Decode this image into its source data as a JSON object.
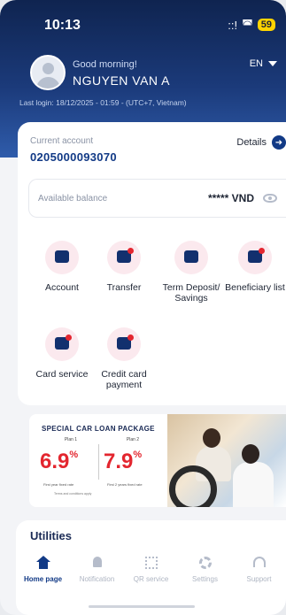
{
  "status_bar": {
    "time": "10:13",
    "signal": "::!",
    "wifi": "wifi-icon",
    "battery": "59"
  },
  "user": {
    "greeting": "Good morning!",
    "name": "NGUYEN VAN A",
    "last_login": "Last login: 18/12/2025 - 01:59 - (UTC+7, Vietnam)"
  },
  "language": "EN",
  "account": {
    "label": "Current account",
    "number": "0205000093070",
    "details_label": "Details",
    "balance_label": "Available balance",
    "balance_value": "***** VND"
  },
  "features": [
    {
      "label": "Account",
      "icon": "wallet-icon"
    },
    {
      "label": "Transfer",
      "icon": "transfer-icon"
    },
    {
      "label": "Term Deposit/ Savings",
      "icon": "piggy-bank-icon"
    },
    {
      "label": "Beneficiary list",
      "icon": "contacts-book-icon"
    },
    {
      "label": "Card service",
      "icon": "card-icon"
    },
    {
      "label": "Credit card payment",
      "icon": "card-payment-icon"
    }
  ],
  "banner": {
    "title": "SPECIAL CAR LOAN PACKAGE",
    "plan1_label": "Plan 1",
    "plan2_label": "Plan 2",
    "rate1": "6.9",
    "rate2": "7.9",
    "pct": "%",
    "note1": "First year fixed rate",
    "note2": "First 2 years fixed rate",
    "note3": "Terms and conditions apply"
  },
  "utilities_title": "Utilities",
  "nav": [
    {
      "label": "Home page",
      "icon": "home-icon",
      "active": true
    },
    {
      "label": "Notification",
      "icon": "bell-icon",
      "active": false
    },
    {
      "label": "QR service",
      "icon": "qr-icon",
      "active": false
    },
    {
      "label": "Settings",
      "icon": "gear-icon",
      "active": false
    },
    {
      "label": "Support",
      "icon": "headset-icon",
      "active": false
    }
  ],
  "colors": {
    "primary": "#123a86",
    "accent": "#e3262f",
    "header_top": "#0f2450"
  }
}
